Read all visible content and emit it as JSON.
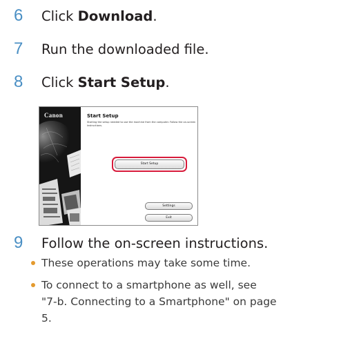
{
  "steps": [
    {
      "num": "6",
      "text": "Click ",
      "bold": "Download",
      "tail": "."
    },
    {
      "num": "7",
      "text": "Run the downloaded file."
    },
    {
      "num": "8",
      "text": "Click ",
      "bold": "Start Setup",
      "tail": "."
    },
    {
      "num": "9",
      "text": "Follow the on-screen instructions."
    }
  ],
  "screenshot": {
    "brand": "Canon",
    "title": "Start Setup",
    "description": "Starting the setup needed to use the machine from the computer. Follow the on-screen instructions.",
    "start_button": "Start Setup",
    "settings_button": "Settings",
    "exit_button": "Exit",
    "highlight_color": "#d71a3a"
  },
  "bullets": [
    "These operations may take some time.",
    "To connect to a smartphone as well, see",
    "\"7-b. Connecting to a Smartphone\" on page",
    "5."
  ],
  "colors": {
    "step_number": "#4a8fc4",
    "bullet": "#e49a2e"
  }
}
